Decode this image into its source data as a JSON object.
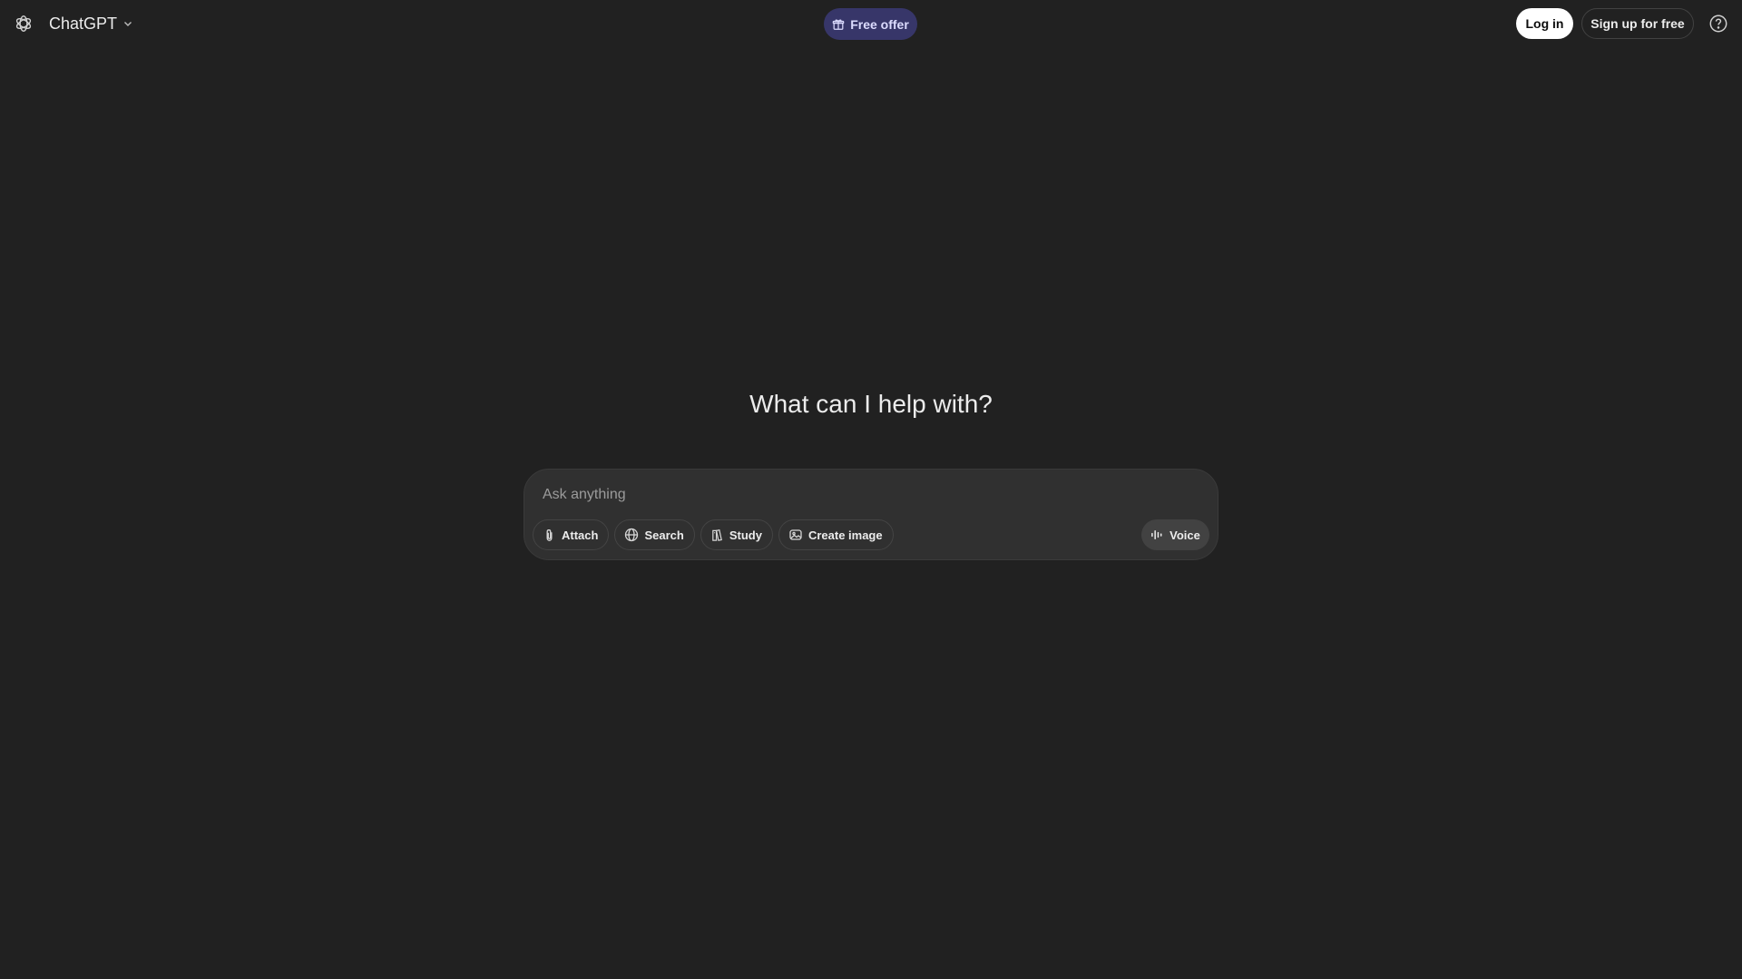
{
  "header": {
    "model_label": "ChatGPT",
    "free_offer_label": "Free offer",
    "login_label": "Log in",
    "signup_label": "Sign up for free"
  },
  "hero": {
    "title": "What can I help with?"
  },
  "composer": {
    "placeholder": "Ask anything",
    "tools": [
      {
        "label": "Attach",
        "icon": "paperclip-icon"
      },
      {
        "label": "Search",
        "icon": "globe-icon"
      },
      {
        "label": "Study",
        "icon": "book-icon"
      },
      {
        "label": "Create image",
        "icon": "image-icon"
      }
    ],
    "voice_label": "Voice"
  },
  "colors": {
    "background": "#212121",
    "composer_bg": "#303030",
    "free_offer_bg": "#373669",
    "text": "#ececec"
  }
}
